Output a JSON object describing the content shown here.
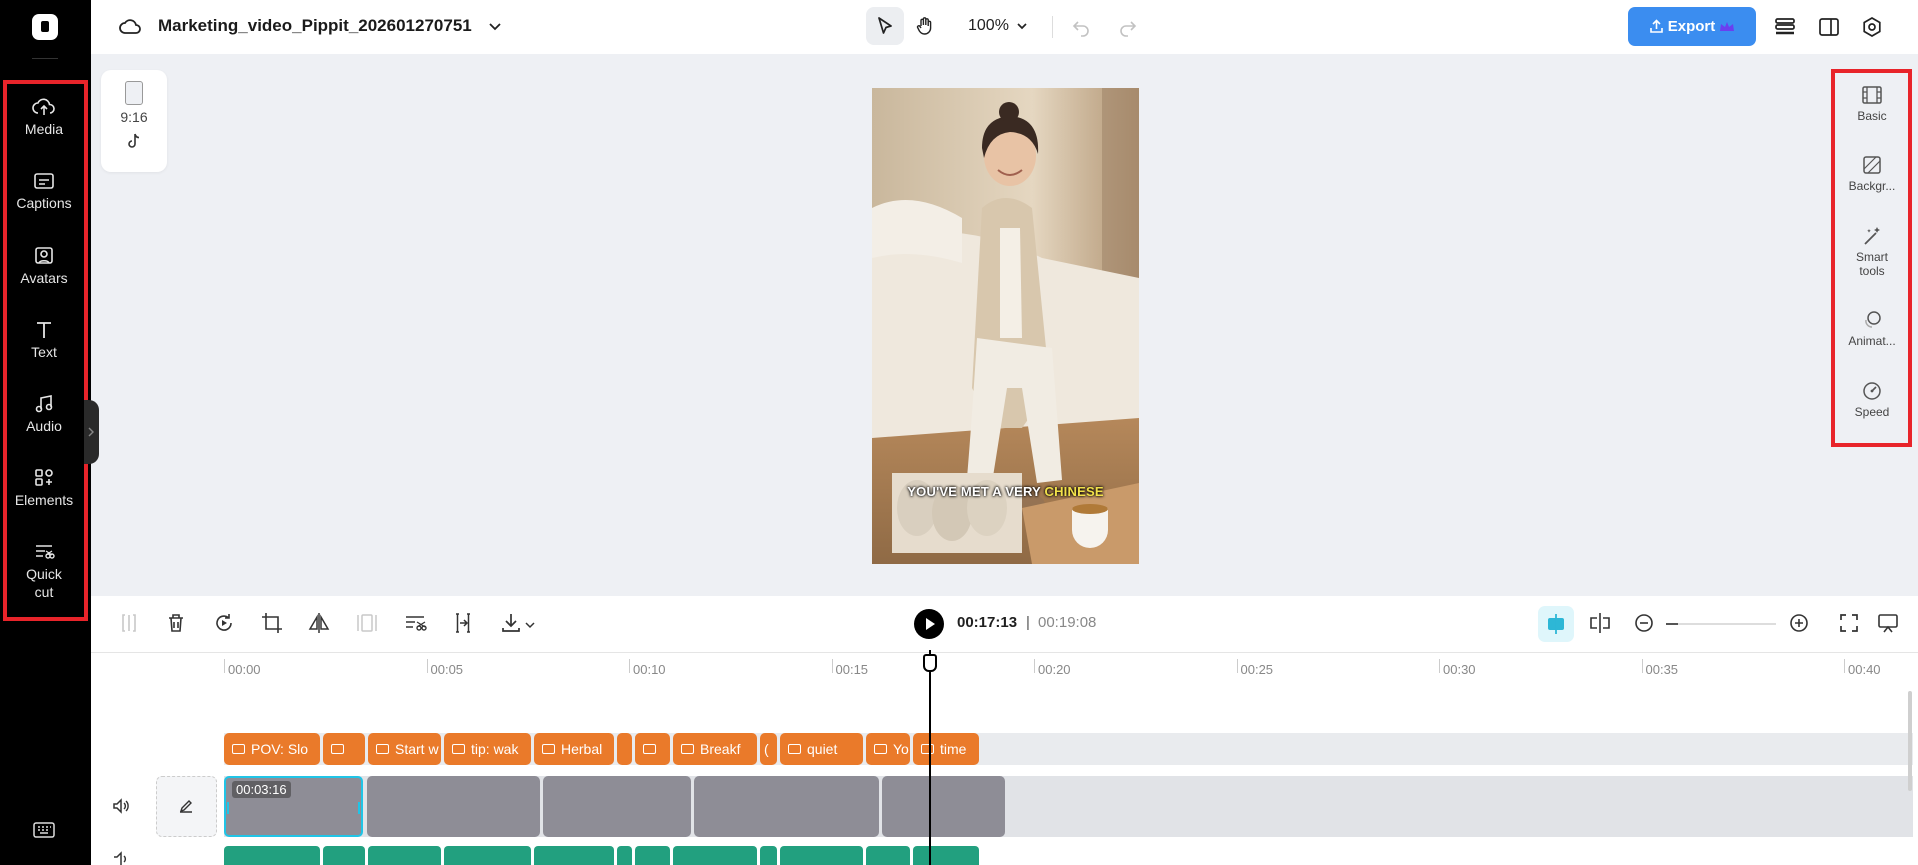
{
  "project": {
    "title": "Marketing_video_Pippit_202601270751"
  },
  "header": {
    "zoom": "100%",
    "export_label": "Export"
  },
  "rail": {
    "items": [
      {
        "label": "Media",
        "icon": "cloud-upload-icon"
      },
      {
        "label": "Captions",
        "icon": "captions-icon"
      },
      {
        "label": "Avatars",
        "icon": "avatar-icon"
      },
      {
        "label": "Text",
        "icon": "text-icon"
      },
      {
        "label": "Audio",
        "icon": "music-note-icon"
      },
      {
        "label": "Elements",
        "icon": "elements-icon"
      },
      {
        "label": "Quick cut",
        "icon": "quick-cut-icon"
      }
    ]
  },
  "canvas": {
    "aspect_ratio": "9:16",
    "platform_icon": "tiktok-icon",
    "caption_prefix": "YOU'VE MET A VERY ",
    "caption_highlight": "CHINESE"
  },
  "right_panel": {
    "items": [
      {
        "label": "Basic",
        "icon": "film-icon"
      },
      {
        "label": "Backgr...",
        "icon": "background-icon"
      },
      {
        "label": "Smart tools",
        "icon": "magic-wand-icon"
      },
      {
        "label": "Animat...",
        "icon": "animation-icon"
      },
      {
        "label": "Speed",
        "icon": "speed-icon"
      }
    ]
  },
  "timeline": {
    "current_time": "00:17:13",
    "separator": "|",
    "total_time": "00:19:08",
    "ruler_labels": [
      "00:00",
      "00:05",
      "00:10",
      "00:15",
      "00:20",
      "00:25",
      "00:30",
      "00:35",
      "00:40"
    ],
    "selected_clip_duration": "00:03:16",
    "caption_chips": [
      "POV: Slo",
      "",
      "Start w",
      "tip: wak",
      "Herbal",
      "",
      "",
      "Breakf",
      "(",
      "quiet",
      "Yo",
      "time"
    ]
  },
  "colors": {
    "accent": "#3b8df0",
    "highlight_red": "#e8242a",
    "caption_chip": "#ea7a2a",
    "audio_clip": "#22a07f",
    "selected_clip_border": "#20c4e6"
  }
}
